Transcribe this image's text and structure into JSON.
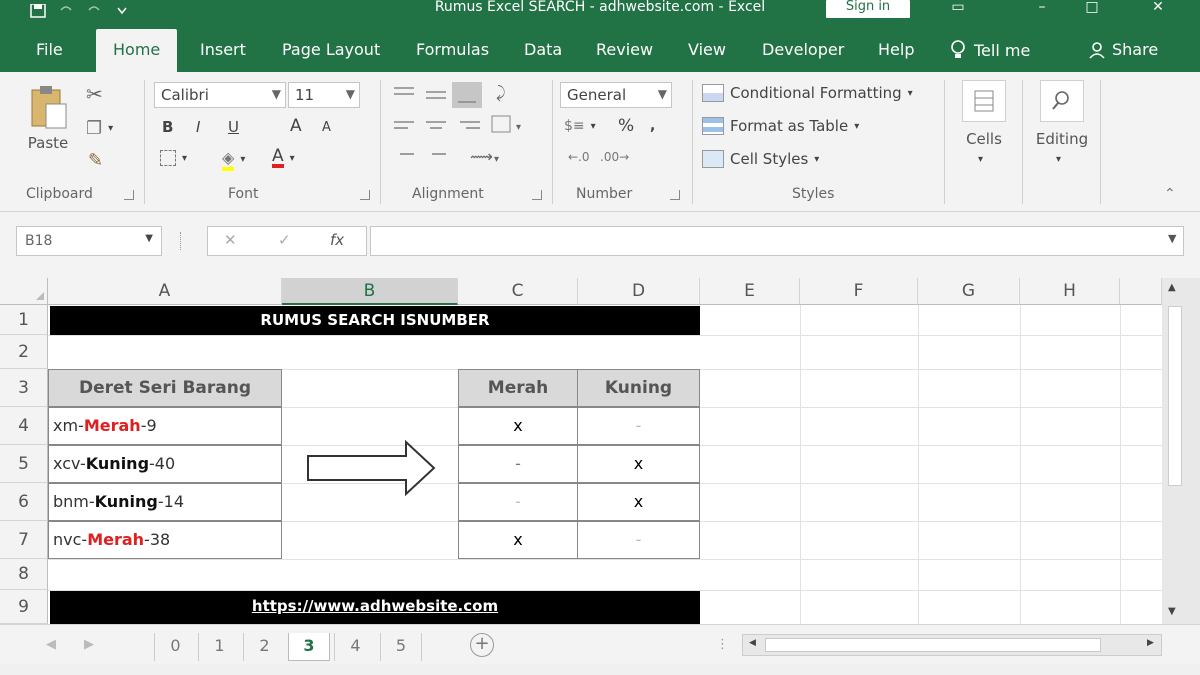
{
  "window": {
    "title": "Rumus Excel SEARCH - adhwebsite.com  -  Excel",
    "sign_in": "Sign in"
  },
  "tabs": [
    "File",
    "Home",
    "Insert",
    "Page Layout",
    "Formulas",
    "Data",
    "Review",
    "View",
    "Developer",
    "Help"
  ],
  "tell_me": "Tell me",
  "share": "Share",
  "ribbon": {
    "clipboard": {
      "paste": "Paste",
      "label": "Clipboard"
    },
    "font": {
      "name": "Calibri",
      "size": "11",
      "bold": "B",
      "italic": "I",
      "underline": "U",
      "grow": "A",
      "shrink": "A",
      "label": "Font"
    },
    "alignment": {
      "label": "Alignment"
    },
    "number": {
      "format": "General",
      "percent": "%",
      "label": "Number"
    },
    "styles": {
      "conditional": "Conditional Formatting",
      "table": "Format as Table",
      "cell_styles": "Cell Styles",
      "label": "Styles"
    },
    "cells": {
      "label": "Cells"
    },
    "editing": {
      "label": "Editing"
    }
  },
  "formula_bar": {
    "name_box": "B18",
    "fx": "fx",
    "value": ""
  },
  "columns": [
    "A",
    "B",
    "C",
    "D",
    "E",
    "F",
    "G",
    "H"
  ],
  "rows": [
    "1",
    "2",
    "3",
    "4",
    "5",
    "6",
    "7",
    "8",
    "9"
  ],
  "sheet": {
    "title_banner": "RUMUS SEARCH ISNUMBER",
    "list_header": "Deret Seri Barang",
    "items": [
      {
        "pre": "xm-",
        "key": "Merah",
        "post": "-9",
        "kind": "red"
      },
      {
        "pre": "xcv-",
        "key": "Kuning",
        "post": "-40",
        "kind": "blk"
      },
      {
        "pre": "bnm-",
        "key": "Kuning",
        "post": "-14",
        "kind": "blk"
      },
      {
        "pre": "nvc-",
        "key": "Merah",
        "post": "-38",
        "kind": "red"
      }
    ],
    "result_headers": [
      "Merah",
      "Kuning"
    ],
    "results": [
      [
        "x",
        "-"
      ],
      [
        "-",
        "x"
      ],
      [
        "-",
        "x"
      ],
      [
        "x",
        "-"
      ]
    ],
    "footer_banner": "https://www.adhwebsite.com"
  },
  "sheet_tabs": [
    "0",
    "1",
    "2",
    "3",
    "4",
    "5"
  ],
  "active_sheet": "3",
  "colors": {
    "excel_green": "#217346",
    "red_text": "#e02020"
  }
}
